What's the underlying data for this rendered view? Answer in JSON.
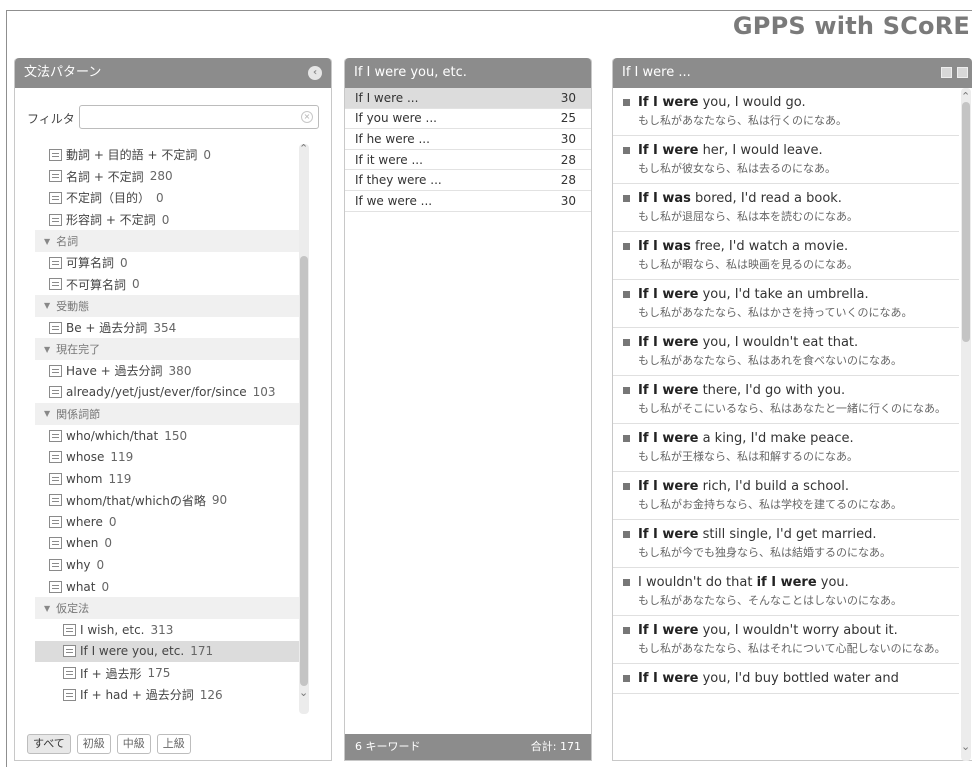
{
  "app_title": "GPPS with SCoRE",
  "left_panel": {
    "title": "文法パターン",
    "filter_label": "フィルタ",
    "filter_value": "",
    "tree": [
      {
        "type": "item",
        "label": "動詞 + 目的語 + 不定詞",
        "count": "0"
      },
      {
        "type": "item",
        "label": "名詞 + 不定詞",
        "count": "280"
      },
      {
        "type": "item",
        "label": "不定詞（目的）",
        "count": "0"
      },
      {
        "type": "item",
        "label": "形容詞 + 不定詞",
        "count": "0"
      },
      {
        "type": "group",
        "label": "名詞"
      },
      {
        "type": "item",
        "label": "可算名詞",
        "count": "0"
      },
      {
        "type": "item",
        "label": "不可算名詞",
        "count": "0"
      },
      {
        "type": "group",
        "label": "受動態"
      },
      {
        "type": "item",
        "label": "Be + 過去分詞",
        "count": "354"
      },
      {
        "type": "group",
        "label": "現在完了"
      },
      {
        "type": "item",
        "label": "Have + 過去分詞",
        "count": "380"
      },
      {
        "type": "item",
        "label": "already/yet/just/ever/for/since",
        "count": "103"
      },
      {
        "type": "group",
        "label": "関係詞節"
      },
      {
        "type": "item",
        "label": "who/which/that",
        "count": "150"
      },
      {
        "type": "item",
        "label": "whose",
        "count": "119"
      },
      {
        "type": "item",
        "label": "whom",
        "count": "119"
      },
      {
        "type": "item",
        "label": "whom/that/whichの省略",
        "count": "90"
      },
      {
        "type": "item",
        "label": "where",
        "count": "0"
      },
      {
        "type": "item",
        "label": "when",
        "count": "0"
      },
      {
        "type": "item",
        "label": "why",
        "count": "0"
      },
      {
        "type": "item",
        "label": "what",
        "count": "0"
      },
      {
        "type": "group",
        "label": "仮定法"
      },
      {
        "type": "deep",
        "label": "I wish, etc.",
        "count": "313"
      },
      {
        "type": "deep",
        "label": "If I were you, etc.",
        "count": "171",
        "selected": true
      },
      {
        "type": "deep",
        "label": "If + 過去形",
        "count": "175"
      },
      {
        "type": "deep",
        "label": "If + had + 過去分詞",
        "count": "126"
      }
    ],
    "levels": [
      "すべて",
      "初級",
      "中級",
      "上級"
    ]
  },
  "middle_panel": {
    "title": "If I were you, etc.",
    "keywords": [
      {
        "label": "If I were ...",
        "count": "30",
        "selected": true
      },
      {
        "label": "If you were ...",
        "count": "25"
      },
      {
        "label": "If he were ...",
        "count": "30"
      },
      {
        "label": "If it were ...",
        "count": "28"
      },
      {
        "label": "If they were ...",
        "count": "28"
      },
      {
        "label": "If we were ...",
        "count": "30"
      }
    ],
    "footer_left": "6 キーワード",
    "footer_right": "合計: 171"
  },
  "right_panel": {
    "title": "If I were ...",
    "examples": [
      {
        "pre": "",
        "bold": "If I were",
        "post": " you, I would go.",
        "ja": "もし私があなたなら、私は行くのになあ。"
      },
      {
        "pre": "",
        "bold": "If I were",
        "post": " her, I would leave.",
        "ja": "もし私が彼女なら、私は去るのになあ。"
      },
      {
        "pre": "",
        "bold": "If I was",
        "post": " bored, I'd read a book.",
        "ja": "もし私が退屈なら、私は本を読むのになあ。"
      },
      {
        "pre": "",
        "bold": "If I was",
        "post": " free, I'd watch a movie.",
        "ja": "もし私が暇なら、私は映画を見るのになあ。"
      },
      {
        "pre": "",
        "bold": "If I were",
        "post": " you, I'd take an umbrella.",
        "ja": "もし私があなたなら、私はかさを持っていくのになあ。"
      },
      {
        "pre": "",
        "bold": "If I were",
        "post": " you, I wouldn't eat that.",
        "ja": "もし私があなたなら、私はあれを食べないのになあ。"
      },
      {
        "pre": "",
        "bold": "If I were",
        "post": " there, I'd go with you.",
        "ja": "もし私がそこにいるなら、私はあなたと一緒に行くのになあ。"
      },
      {
        "pre": "",
        "bold": "If I were",
        "post": " a king, I'd make peace.",
        "ja": "もし私が王様なら、私は和解するのになあ。"
      },
      {
        "pre": "",
        "bold": "If I were",
        "post": " rich, I'd build a school.",
        "ja": "もし私がお金持ちなら、私は学校を建てるのになあ。"
      },
      {
        "pre": "",
        "bold": "If I were",
        "post": " still single, I'd get married.",
        "ja": "もし私が今でも独身なら、私は結婚するのになあ。"
      },
      {
        "pre": "I wouldn't do that ",
        "bold": "if I were",
        "post": " you.",
        "ja": "もし私があなたなら、そんなことはしないのになあ。"
      },
      {
        "pre": "",
        "bold": "If I were",
        "post": " you, I wouldn't worry about it.",
        "ja": "もし私があなたなら、私はそれについて心配しないのになあ。"
      },
      {
        "pre": "",
        "bold": "If I were",
        "post": " you, I'd buy bottled water and",
        "ja": ""
      }
    ]
  }
}
